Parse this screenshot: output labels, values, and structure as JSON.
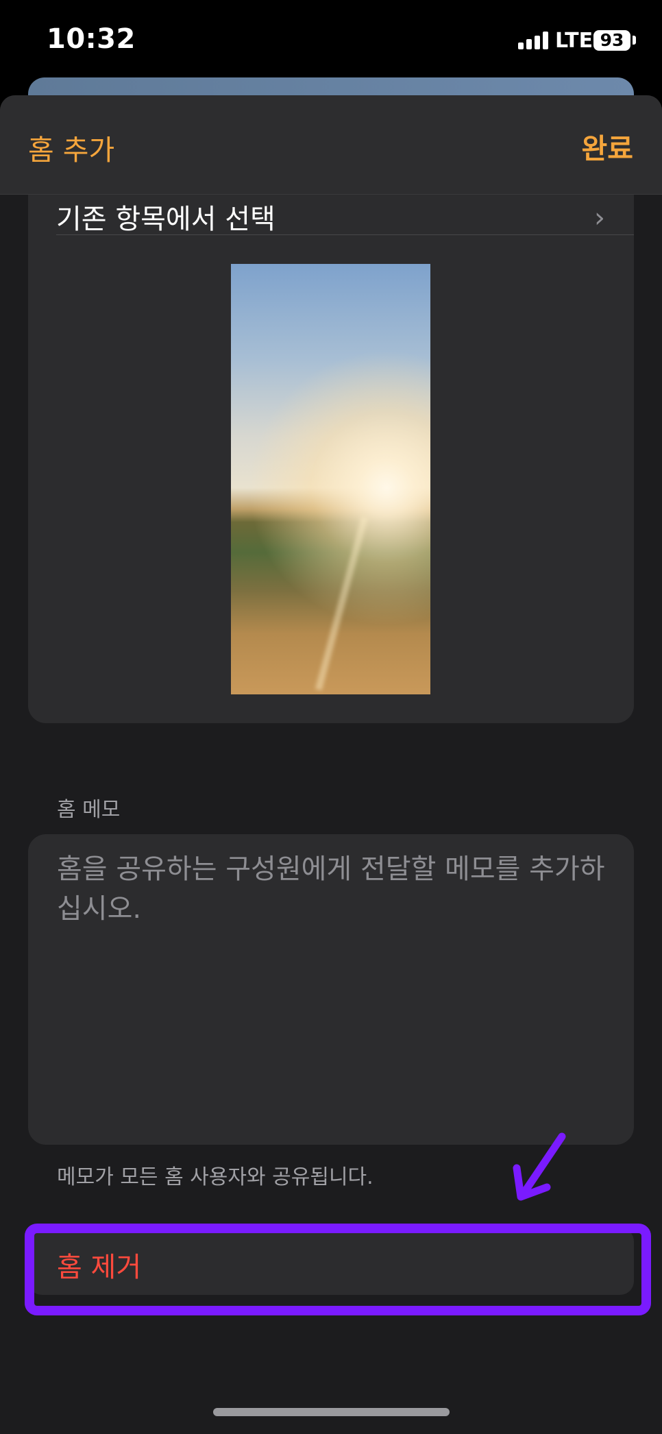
{
  "status_bar": {
    "time": "10:32",
    "network": "LTE",
    "battery": "93"
  },
  "nav": {
    "title": "홈 추가",
    "done": "완료"
  },
  "wallpaper_section": {
    "choose_label": "기존 항목에서 선택",
    "chevron_icon": "chevron-right-icon"
  },
  "memo": {
    "header": "홈 메모",
    "placeholder": "홈을 공유하는 구성원에게 전달할 메모를 추가하십시오.",
    "footer": "메모가 모든 홈 사용자와 공유됩니다."
  },
  "actions": {
    "remove_home": "홈 제거"
  },
  "colors": {
    "accent": "#f5a53c",
    "destructive": "#ff4a3d",
    "annotation": "#7a1bff",
    "background": "#1c1c1e",
    "card": "#2c2c2e"
  }
}
